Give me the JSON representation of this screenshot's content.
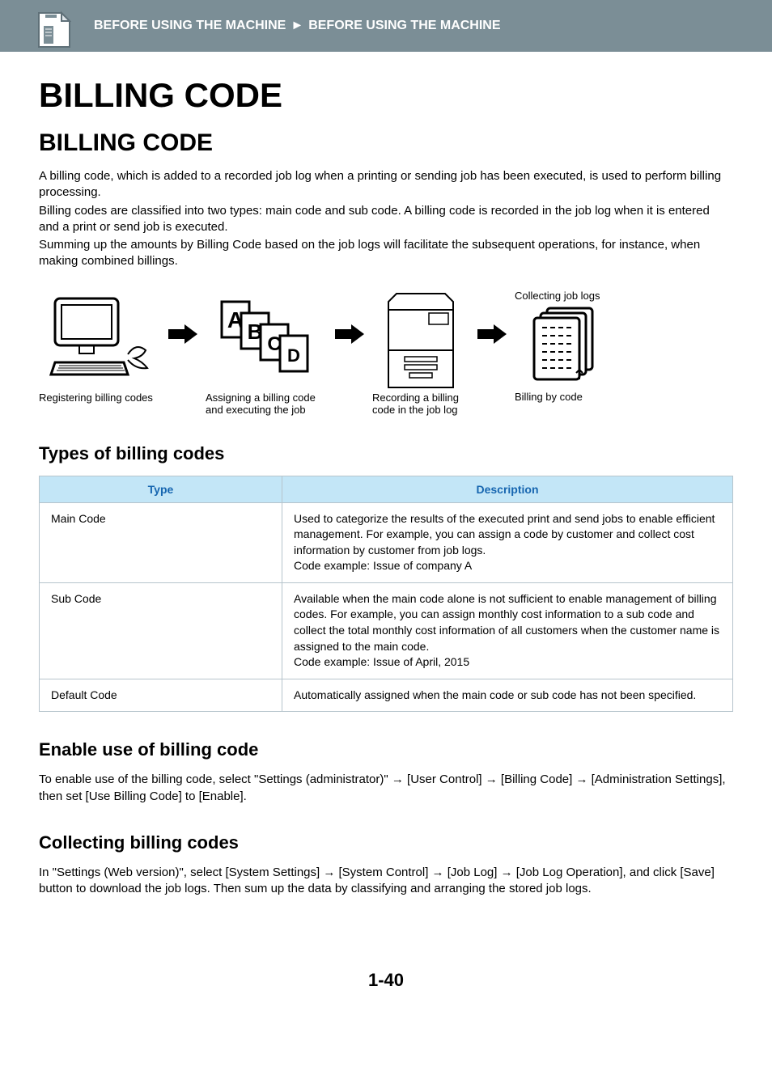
{
  "header": {
    "breadcrumb_left": "BEFORE USING THE MACHINE",
    "breadcrumb_sep": "►",
    "breadcrumb_right": "BEFORE USING THE MACHINE"
  },
  "title_main": "BILLING CODE",
  "title_sub": "BILLING CODE",
  "intro": {
    "p1": "A billing code, which is added to a recorded job log when a printing or sending job has been executed, is used to perform billing processing.",
    "p2": "Billing codes are classified into two types: main code and sub code. A billing code is recorded in the job log when it is entered and a print or send job is executed.",
    "p3": "Summing up the amounts by Billing Code based on the job logs will facilitate the subsequent operations, for instance, when making combined billings."
  },
  "diagram": {
    "collecting_label": "Collecting job logs",
    "captions": {
      "c1": "Registering billing codes",
      "c2": "Assigning a billing code and executing the job",
      "c3": "Recording a billing code in the job log",
      "c4": "Billing by code"
    },
    "codes_letters": {
      "a": "A",
      "b": "B",
      "c": "C",
      "d": "D"
    }
  },
  "section_types": {
    "heading": "Types of billing codes",
    "header_type": "Type",
    "header_desc": "Description",
    "rows": [
      {
        "type": "Main Code",
        "desc": "Used to categorize the results of the executed print and send jobs to enable efficient management. For example, you can assign a code by customer and collect cost information by customer from job logs.\nCode example: Issue of company A"
      },
      {
        "type": "Sub Code",
        "desc": "Available when the main code alone is not sufficient to enable management of billing codes. For example, you can assign monthly cost information to a sub code and collect the total monthly cost information of all customers when the customer name is assigned to the main code.\nCode example: Issue of April, 2015"
      },
      {
        "type": "Default Code",
        "desc": "Automatically assigned when the main code or sub code has not been specified."
      }
    ]
  },
  "section_enable": {
    "heading": "Enable use of billing code",
    "body": "To enable use of the billing code, select \"Settings (administrator)\" → [User Control] → [Billing Code] → [Administration Settings], then set [Use Billing Code] to [Enable]."
  },
  "section_collect": {
    "heading": "Collecting billing codes",
    "body": "In \"Settings  (Web version)\", select [System Settings] → [System Control] → [Job Log] → [Job Log Operation], and click [Save] button to download the job logs. Then sum up the data by classifying and arranging the stored job logs."
  },
  "page_number": "1-40"
}
